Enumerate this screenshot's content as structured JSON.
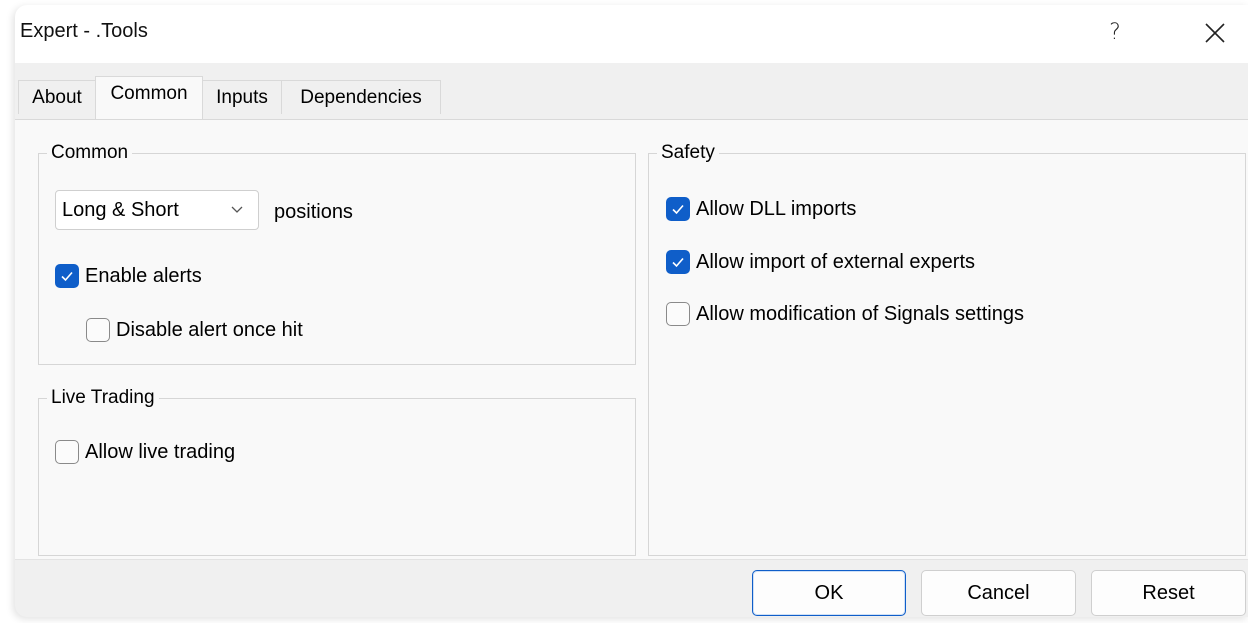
{
  "window": {
    "title": "Expert - .Tools",
    "help_label": "?",
    "close_icon": "close-icon"
  },
  "tabs": [
    {
      "label": "About",
      "active": false
    },
    {
      "label": "Common",
      "active": true
    },
    {
      "label": "Inputs",
      "active": false
    },
    {
      "label": "Dependencies",
      "active": false
    }
  ],
  "common_group": {
    "legend": "Common",
    "position_mode": {
      "selected": "Long & Short"
    },
    "positions_label": "positions",
    "enable_alerts": {
      "label": "Enable alerts",
      "checked": true
    },
    "disable_alert_once_hit": {
      "label": "Disable alert once hit",
      "checked": false
    }
  },
  "live_trading_group": {
    "legend": "Live Trading",
    "allow_live_trading": {
      "label": "Allow live trading",
      "checked": false
    }
  },
  "safety_group": {
    "legend": "Safety",
    "allow_dll_imports": {
      "label": "Allow DLL imports",
      "checked": true
    },
    "allow_import_external_experts": {
      "label": "Allow import of external experts",
      "checked": true
    },
    "allow_modify_signals": {
      "label": "Allow modification of Signals settings",
      "checked": false
    }
  },
  "buttons": {
    "ok": "OK",
    "cancel": "Cancel",
    "reset": "Reset"
  },
  "colors": {
    "accent": "#0f5ec9",
    "dialog_bg": "#f0f0f0",
    "panel_bg": "#f9f9f9"
  }
}
